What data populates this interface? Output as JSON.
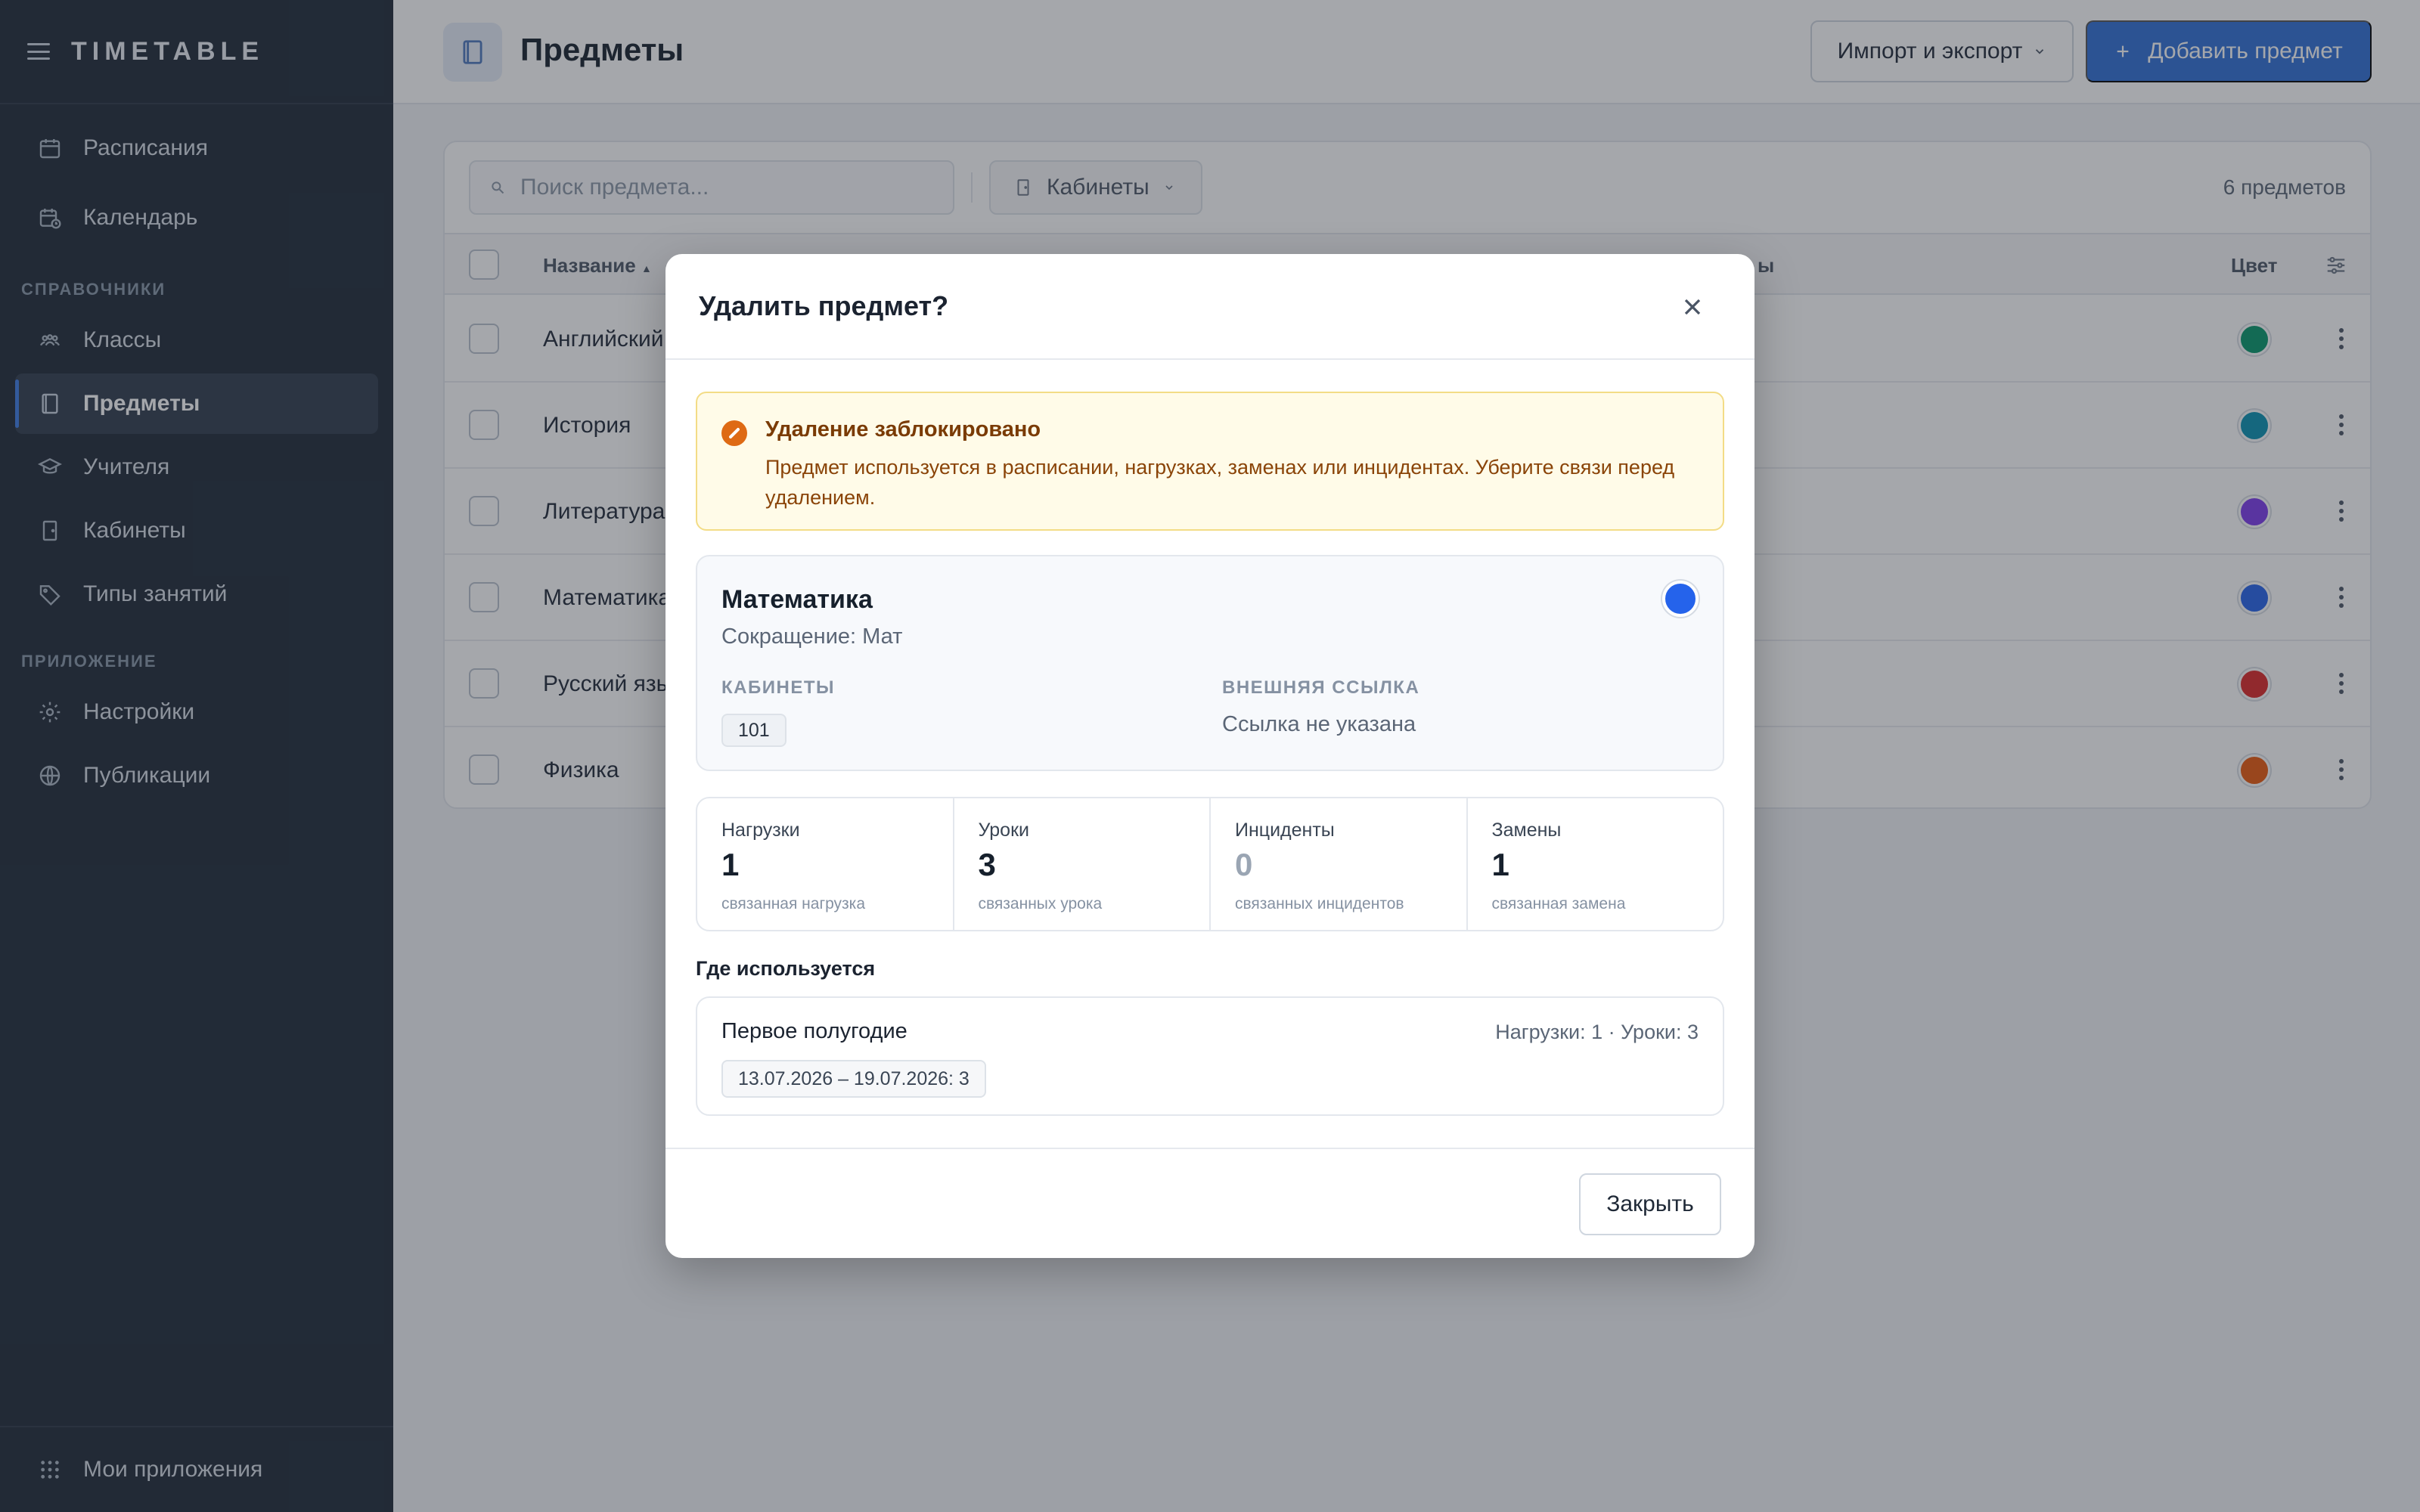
{
  "app": {
    "brand": "TIMETABLE"
  },
  "sidebar": {
    "items_top": [
      {
        "label": "Расписания",
        "icon": "calendar-icon"
      },
      {
        "label": "Календарь",
        "icon": "calendar-clock-icon"
      }
    ],
    "section_refs": "СПРАВОЧНИКИ",
    "items_refs": [
      {
        "label": "Классы",
        "icon": "users-icon"
      },
      {
        "label": "Предметы",
        "icon": "book-icon",
        "active": true
      },
      {
        "label": "Учителя",
        "icon": "graduation-cap-icon"
      },
      {
        "label": "Кабинеты",
        "icon": "door-icon"
      },
      {
        "label": "Типы занятий",
        "icon": "tag-icon"
      }
    ],
    "section_app": "ПРИЛОЖЕНИЕ",
    "items_app": [
      {
        "label": "Настройки",
        "icon": "gear-icon"
      },
      {
        "label": "Публикации",
        "icon": "globe-icon"
      }
    ],
    "footer": {
      "label": "Мои приложения",
      "icon": "grid-icon"
    }
  },
  "header": {
    "title": "Предметы",
    "import_label": "Импорт и экспорт",
    "add_label": "Добавить предмет"
  },
  "toolbar": {
    "search_placeholder": "Поиск предмета...",
    "filter_label": "Кабинеты",
    "count": "6 предметов"
  },
  "table": {
    "headers": {
      "name": "Название",
      "rooms_tail": "ы",
      "color": "Цвет"
    },
    "rows": [
      {
        "name": "Английский",
        "color": "#059669"
      },
      {
        "name": "История",
        "color": "#0891b2"
      },
      {
        "name": "Литература",
        "color": "#7c3aed"
      },
      {
        "name": "Математика",
        "color": "#2563eb"
      },
      {
        "name": "Русский язык",
        "color": "#dc2626"
      },
      {
        "name": "Физика",
        "color": "#ea580c"
      }
    ]
  },
  "modal": {
    "title": "Удалить предмет?",
    "alert": {
      "title": "Удаление заблокировано",
      "text": "Предмет используется в расписании, нагрузках, заменах или инцидентах. Уберите связи перед удалением."
    },
    "subject": {
      "name": "Математика",
      "abbr": "Сокращение: Мат",
      "color": "#2563eb",
      "rooms_label": "КАБИНЕТЫ",
      "room": "101",
      "link_label": "ВНЕШНЯЯ ССЫЛКА",
      "link_value": "Ссылка не указана"
    },
    "stats": [
      {
        "label": "Нагрузки",
        "value": "1",
        "sub": "связанная нагрузка"
      },
      {
        "label": "Уроки",
        "value": "3",
        "sub": "связанных урока"
      },
      {
        "label": "Инциденты",
        "value": "0",
        "sub": "связанных инцидентов"
      },
      {
        "label": "Замены",
        "value": "1",
        "sub": "связанная замена"
      }
    ],
    "where_title": "Где используется",
    "where": {
      "name": "Первое полугодие",
      "meta": "Нагрузки: 1 · Уроки: 3",
      "range": "13.07.2026 – 19.07.2026: 3"
    },
    "close_label": "Закрыть"
  }
}
